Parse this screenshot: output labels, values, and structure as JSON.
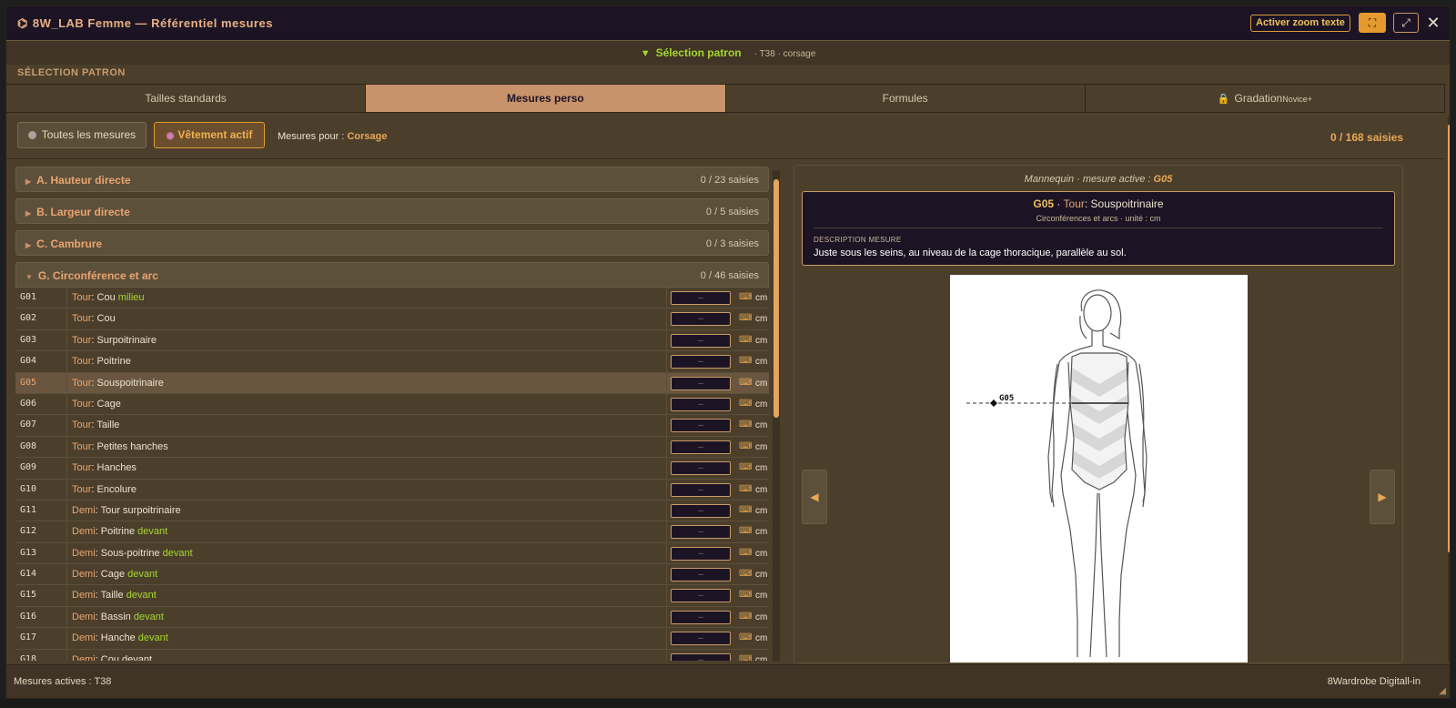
{
  "window": {
    "title": "8W_LAB Femme — Référentiel mesures",
    "zoom_button": "Activer zoom texte"
  },
  "selection": {
    "title": "Sélection patron",
    "subtitle": "· T38 · corsage",
    "section_label": "SÉLECTION PATRON"
  },
  "tabs": [
    {
      "label": "Tailles standards"
    },
    {
      "label": "Mesures perso"
    },
    {
      "label": "Formules"
    },
    {
      "label": "Gradation",
      "badge": "Novice+"
    }
  ],
  "filters": {
    "all_label": "Toutes les mesures",
    "active_label": "Vêtement actif",
    "mesures_pour_label": "Mesures pour :",
    "mesures_pour_value": "Corsage",
    "total": "0 / 168 saisies"
  },
  "groups": [
    {
      "title": "A. Hauteur directe",
      "count": "0 / 23 saisies"
    },
    {
      "title": "B. Largeur directe",
      "count": "0 / 5 saisies"
    },
    {
      "title": "C. Cambrure",
      "count": "0 / 3 saisies"
    },
    {
      "title": "G. Circonférence et arc",
      "count": "0 / 46 saisies"
    }
  ],
  "rows": [
    {
      "code": "G01",
      "prefix": "Tour",
      "name": ": Cou ",
      "hl": "milieu",
      "value": "--",
      "unit": "cm"
    },
    {
      "code": "G02",
      "prefix": "Tour",
      "name": ": Cou",
      "hl": "",
      "value": "--",
      "unit": "cm"
    },
    {
      "code": "G03",
      "prefix": "Tour",
      "name": ": Surpoitrinaire",
      "hl": "",
      "value": "--",
      "unit": "cm"
    },
    {
      "code": "G04",
      "prefix": "Tour",
      "name": ": Poitrine",
      "hl": "",
      "value": "--",
      "unit": "cm"
    },
    {
      "code": "G05",
      "prefix": "Tour",
      "name": ": Souspoitrinaire",
      "hl": "",
      "value": "--",
      "unit": "cm"
    },
    {
      "code": "G06",
      "prefix": "Tour",
      "name": ": Cage",
      "hl": "",
      "value": "--",
      "unit": "cm"
    },
    {
      "code": "G07",
      "prefix": "Tour",
      "name": ": Taille",
      "hl": "",
      "value": "--",
      "unit": "cm"
    },
    {
      "code": "G08",
      "prefix": "Tour",
      "name": ": Petites hanches",
      "hl": "",
      "value": "--",
      "unit": "cm"
    },
    {
      "code": "G09",
      "prefix": "Tour",
      "name": ": Hanches",
      "hl": "",
      "value": "--",
      "unit": "cm"
    },
    {
      "code": "G10",
      "prefix": "Tour",
      "name": ": Encolure",
      "hl": "",
      "value": "--",
      "unit": "cm"
    },
    {
      "code": "G11",
      "prefix": "Demi",
      "name": ": Tour surpoitrinaire",
      "hl": "",
      "value": "--",
      "unit": "cm"
    },
    {
      "code": "G12",
      "prefix": "Demi",
      "name": ": Poitrine ",
      "hl": "devant",
      "value": "--",
      "unit": "cm"
    },
    {
      "code": "G13",
      "prefix": "Demi",
      "name": ": Sous-poitrine ",
      "hl": "devant",
      "value": "--",
      "unit": "cm"
    },
    {
      "code": "G14",
      "prefix": "Demi",
      "name": ": Cage ",
      "hl": "devant",
      "value": "--",
      "unit": "cm"
    },
    {
      "code": "G15",
      "prefix": "Demi",
      "name": ": Taille ",
      "hl": "devant",
      "value": "--",
      "unit": "cm"
    },
    {
      "code": "G16",
      "prefix": "Demi",
      "name": ": Bassin ",
      "hl": "devant",
      "value": "--",
      "unit": "cm"
    },
    {
      "code": "G17",
      "prefix": "Demi",
      "name": ": Hanche ",
      "hl": "devant",
      "value": "--",
      "unit": "cm"
    },
    {
      "code": "G18",
      "prefix": "Demi",
      "name": ": Cou devant",
      "hl": "",
      "value": "--",
      "unit": "cm"
    }
  ],
  "selected_code": "G05",
  "detail": {
    "caption_prefix": "Mannequin · mesure active : ",
    "caption_code": "G05",
    "code": "G05",
    "sep": " · ",
    "prefix": "Tour",
    "name": ": Souspoitrinaire",
    "sub": "Circonférences et arcs · unité : cm",
    "desc_label": "DESCRIPTION MESURE",
    "desc_text": "Juste sous les seins, au niveau de la cage thoracique, parallèle au sol.",
    "figure_label": "G05"
  },
  "footer": {
    "left": "Mesures actives : T38",
    "right": "8Wardrobe Digitall-in"
  }
}
